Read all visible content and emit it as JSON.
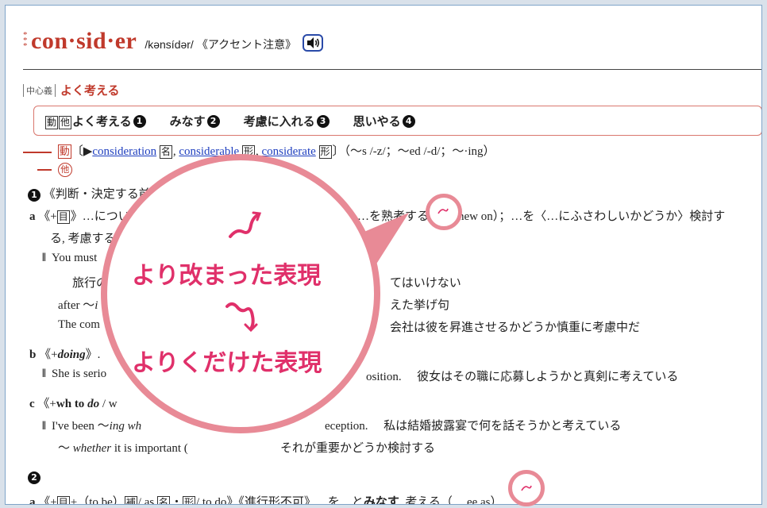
{
  "entry": {
    "stars": "*",
    "headword": "con·sid·er",
    "pronunciation": "/kənsídər/",
    "accent_note": "《アクセント注意》",
    "audio_icon": "speaker-icon"
  },
  "core": {
    "tag": "中心義",
    "text": "よく考える"
  },
  "summary": [
    {
      "label": "よく考える",
      "num": "1"
    },
    {
      "label": "みなす",
      "num": "2"
    },
    {
      "label": "考慮に入れる",
      "num": "3"
    },
    {
      "label": "思いやる",
      "num": "4"
    }
  ],
  "summary_tags": [
    "動",
    "他"
  ],
  "inflection": {
    "pos": "動",
    "open": "〔▶",
    "links": [
      {
        "word": "consideration",
        "tag": "名"
      },
      {
        "word": "considerable",
        "tag": "形"
      },
      {
        "word": "considerate",
        "tag": "形"
      }
    ],
    "forms": "〕（～s /-z/；～ed /-d/；～·ing）",
    "sub_pos": "他"
  },
  "sense1": {
    "num": "1",
    "heading": "《判断・決定する前に",
    "a_label": "a",
    "a_grammar": "《+",
    "a_tag": "目",
    "a_text": "》…につい",
    "a_text2": "；…を熟考する（",
    "a_text3": "hew on）；…を〈…にふさわしいかどうか〉検討す",
    "a_cont": "る, 考慮する《",
    "ex1_en": "You must",
    "ex1_ja": "旅行の",
    "ex1_ja2": "てはいけない",
    "ex2_en_pre": "after ～",
    "ex2_en_it": "i",
    "ex2_ja": "えた挙げ句",
    "ex3_en": "The com",
    "ex3_ja": "会社は彼を昇進させるかどうか慎重に考慮中だ",
    "b_label": "b",
    "b_grammar": "《+",
    "b_it": "doing",
    "b_close": "》.",
    "ex4_en": "She is serio",
    "ex4_en2": "osition.",
    "ex4_ja": "彼女はその職に応募しようかと真剣に考えている",
    "c_label": "c",
    "c_grammar": "《+",
    "c_bold": "wh to ",
    "c_it": "do",
    "c_close": " / w",
    "ex5_en": "I've been ～",
    "ex5_it": "ing wh",
    "ex5_en2": "eception.",
    "ex5_ja": "私は結婚披露宴で何を話そうかと考えている",
    "ex6_en_pre": "～ ",
    "ex6_it": "whether",
    "ex6_en": " it is important (",
    "ex6_ja": "それが重要かどうか検討する"
  },
  "sense2": {
    "num": "2",
    "a_label": "a",
    "a_text1": "《+",
    "a_tag1": "目",
    "a_text2": "+（to be）",
    "a_tag2": "補",
    "a_text3": "/ as ",
    "a_tag3": "名",
    "a_dot": "・",
    "a_tag4": "形",
    "a_text4": "/ to do》《進行形不可》…を…と",
    "a_bold": "みなす",
    "a_text5": ", 考える（",
    "a_text6": "ee as）"
  },
  "callout": {
    "label_formal": "より改まった表現",
    "label_casual": "よりくだけた表現"
  },
  "colors": {
    "accent_red": "#c0392b",
    "callout_pink": "#e88a96",
    "callout_text": "#e0306a",
    "link_blue": "#1f3fbf"
  }
}
